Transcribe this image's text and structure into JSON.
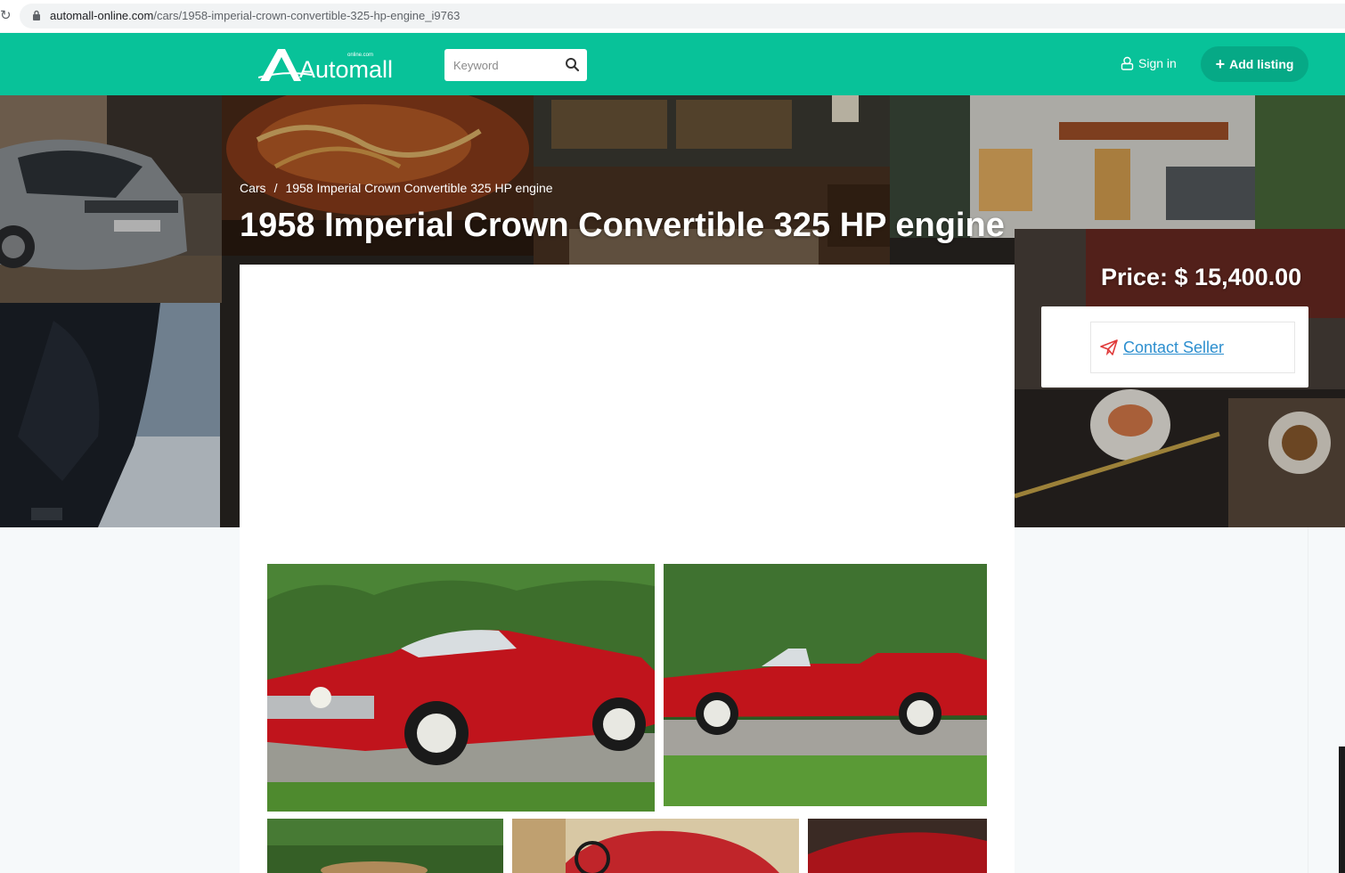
{
  "browser": {
    "reload_icon": "reload-icon",
    "url_host": "automall-online.com",
    "url_path": "/cars/1958-imperial-crown-convertible-325-hp-engine_i9763"
  },
  "header": {
    "logo_text": "Automall",
    "logo_small": "online.com",
    "search_placeholder": "Keyword",
    "signin_label": "Sign in",
    "add_listing_label": "Add listing",
    "brand_color": "#08c299"
  },
  "breadcrumb": {
    "items": [
      "Cars",
      "1958 Imperial Crown Convertible 325 HP engine"
    ],
    "separator": "/"
  },
  "listing": {
    "title": "1958 Imperial Crown Convertible 325 HP engine",
    "price": "Price: $ 15,400.00",
    "contact_label": "Contact Seller"
  }
}
